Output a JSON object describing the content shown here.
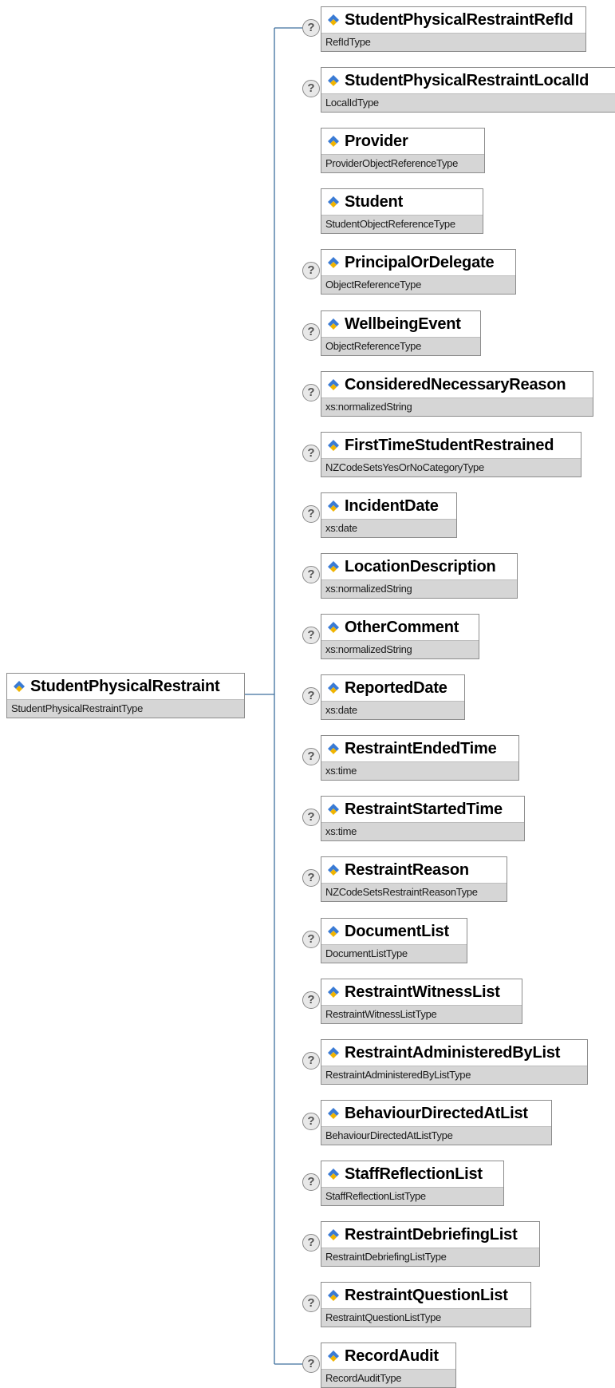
{
  "root": {
    "name": "StudentPhysicalRestraint",
    "type": "StudentPhysicalRestraintType"
  },
  "children": [
    {
      "name": "StudentPhysicalRestraintRefId",
      "type": "RefIdType",
      "optional": true
    },
    {
      "name": "StudentPhysicalRestraintLocalId",
      "type": "LocalIdType",
      "optional": true
    },
    {
      "name": "Provider",
      "type": "ProviderObjectReferenceType",
      "optional": false
    },
    {
      "name": "Student",
      "type": "StudentObjectReferenceType",
      "optional": false
    },
    {
      "name": "PrincipalOrDelegate",
      "type": "ObjectReferenceType",
      "optional": true
    },
    {
      "name": "WellbeingEvent",
      "type": "ObjectReferenceType",
      "optional": true
    },
    {
      "name": "ConsideredNecessaryReason",
      "type": "xs:normalizedString",
      "optional": true
    },
    {
      "name": "FirstTimeStudentRestrained",
      "type": "NZCodeSetsYesOrNoCategoryType",
      "optional": true
    },
    {
      "name": "IncidentDate",
      "type": "xs:date",
      "optional": true
    },
    {
      "name": "LocationDescription",
      "type": "xs:normalizedString",
      "optional": true
    },
    {
      "name": "OtherComment",
      "type": "xs:normalizedString",
      "optional": true
    },
    {
      "name": "ReportedDate",
      "type": "xs:date",
      "optional": true
    },
    {
      "name": "RestraintEndedTime",
      "type": "xs:time",
      "optional": true
    },
    {
      "name": "RestraintStartedTime",
      "type": "xs:time",
      "optional": true
    },
    {
      "name": "RestraintReason",
      "type": "NZCodeSetsRestraintReasonType",
      "optional": true
    },
    {
      "name": "DocumentList",
      "type": "DocumentListType",
      "optional": true
    },
    {
      "name": "RestraintWitnessList",
      "type": "RestraintWitnessListType",
      "optional": true
    },
    {
      "name": "RestraintAdministeredByList",
      "type": "RestraintAdministeredByListType",
      "optional": true
    },
    {
      "name": "BehaviourDirectedAtList",
      "type": "BehaviourDirectedAtListType",
      "optional": true
    },
    {
      "name": "StaffReflectionList",
      "type": "StaffReflectionListType",
      "optional": true
    },
    {
      "name": "RestraintDebriefingList",
      "type": "RestraintDebriefingListType",
      "optional": true
    },
    {
      "name": "RestraintQuestionList",
      "type": "RestraintQuestionListType",
      "optional": true
    },
    {
      "name": "RecordAudit",
      "type": "RecordAuditType",
      "optional": true
    }
  ],
  "optional_marker": "?",
  "icon": "element-diamond-icon",
  "colors": {
    "line": "#3d6f9e",
    "icon_blue": "#3a7bd5",
    "icon_yellow": "#f0b400",
    "type_bg": "#d6d6d6"
  }
}
